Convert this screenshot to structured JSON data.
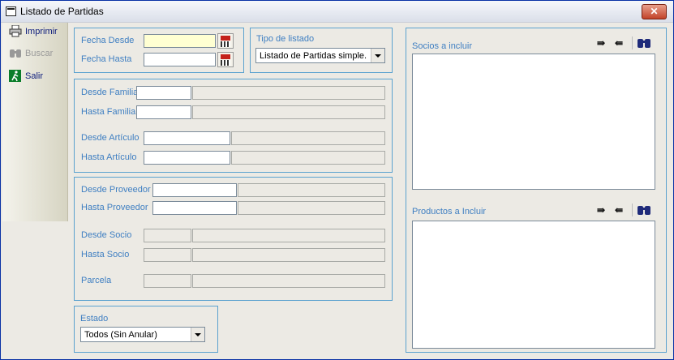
{
  "window": {
    "title": "Listado de Partidas",
    "close_label": "✕"
  },
  "sidebar": {
    "items": [
      {
        "label": "Imprimir",
        "icon": "printer-icon",
        "enabled": true
      },
      {
        "label": "Buscar",
        "icon": "binoculars-icon",
        "enabled": false
      },
      {
        "label": "Salir",
        "icon": "exit-icon",
        "enabled": true
      }
    ]
  },
  "fechas": {
    "desde_label": "Fecha Desde",
    "hasta_label": "Fecha Hasta",
    "desde_value": "",
    "hasta_value": ""
  },
  "tipo_listado": {
    "label": "Tipo de listado",
    "value": "Listado de Partidas simple."
  },
  "familia_articulo": {
    "desde_familia": "Desde Familia",
    "hasta_familia": "Hasta Familia",
    "desde_articulo": "Desde Artículo",
    "hasta_articulo": "Hasta Artículo"
  },
  "proveedor_socio": {
    "desde_proveedor": "Desde Proveedor",
    "hasta_proveedor": "Hasta Proveedor",
    "desde_socio": "Desde Socio",
    "hasta_socio": "Hasta Socio",
    "parcela": "Parcela"
  },
  "estado": {
    "label": "Estado",
    "value": "Todos (Sin Anular)"
  },
  "socios": {
    "label": "Socios a incluir"
  },
  "productos": {
    "label": "Productos a Incluir"
  },
  "toolbar_icons": {
    "add_all": "⇛",
    "remove_all": "⇚",
    "find": "binoculars-icon"
  }
}
